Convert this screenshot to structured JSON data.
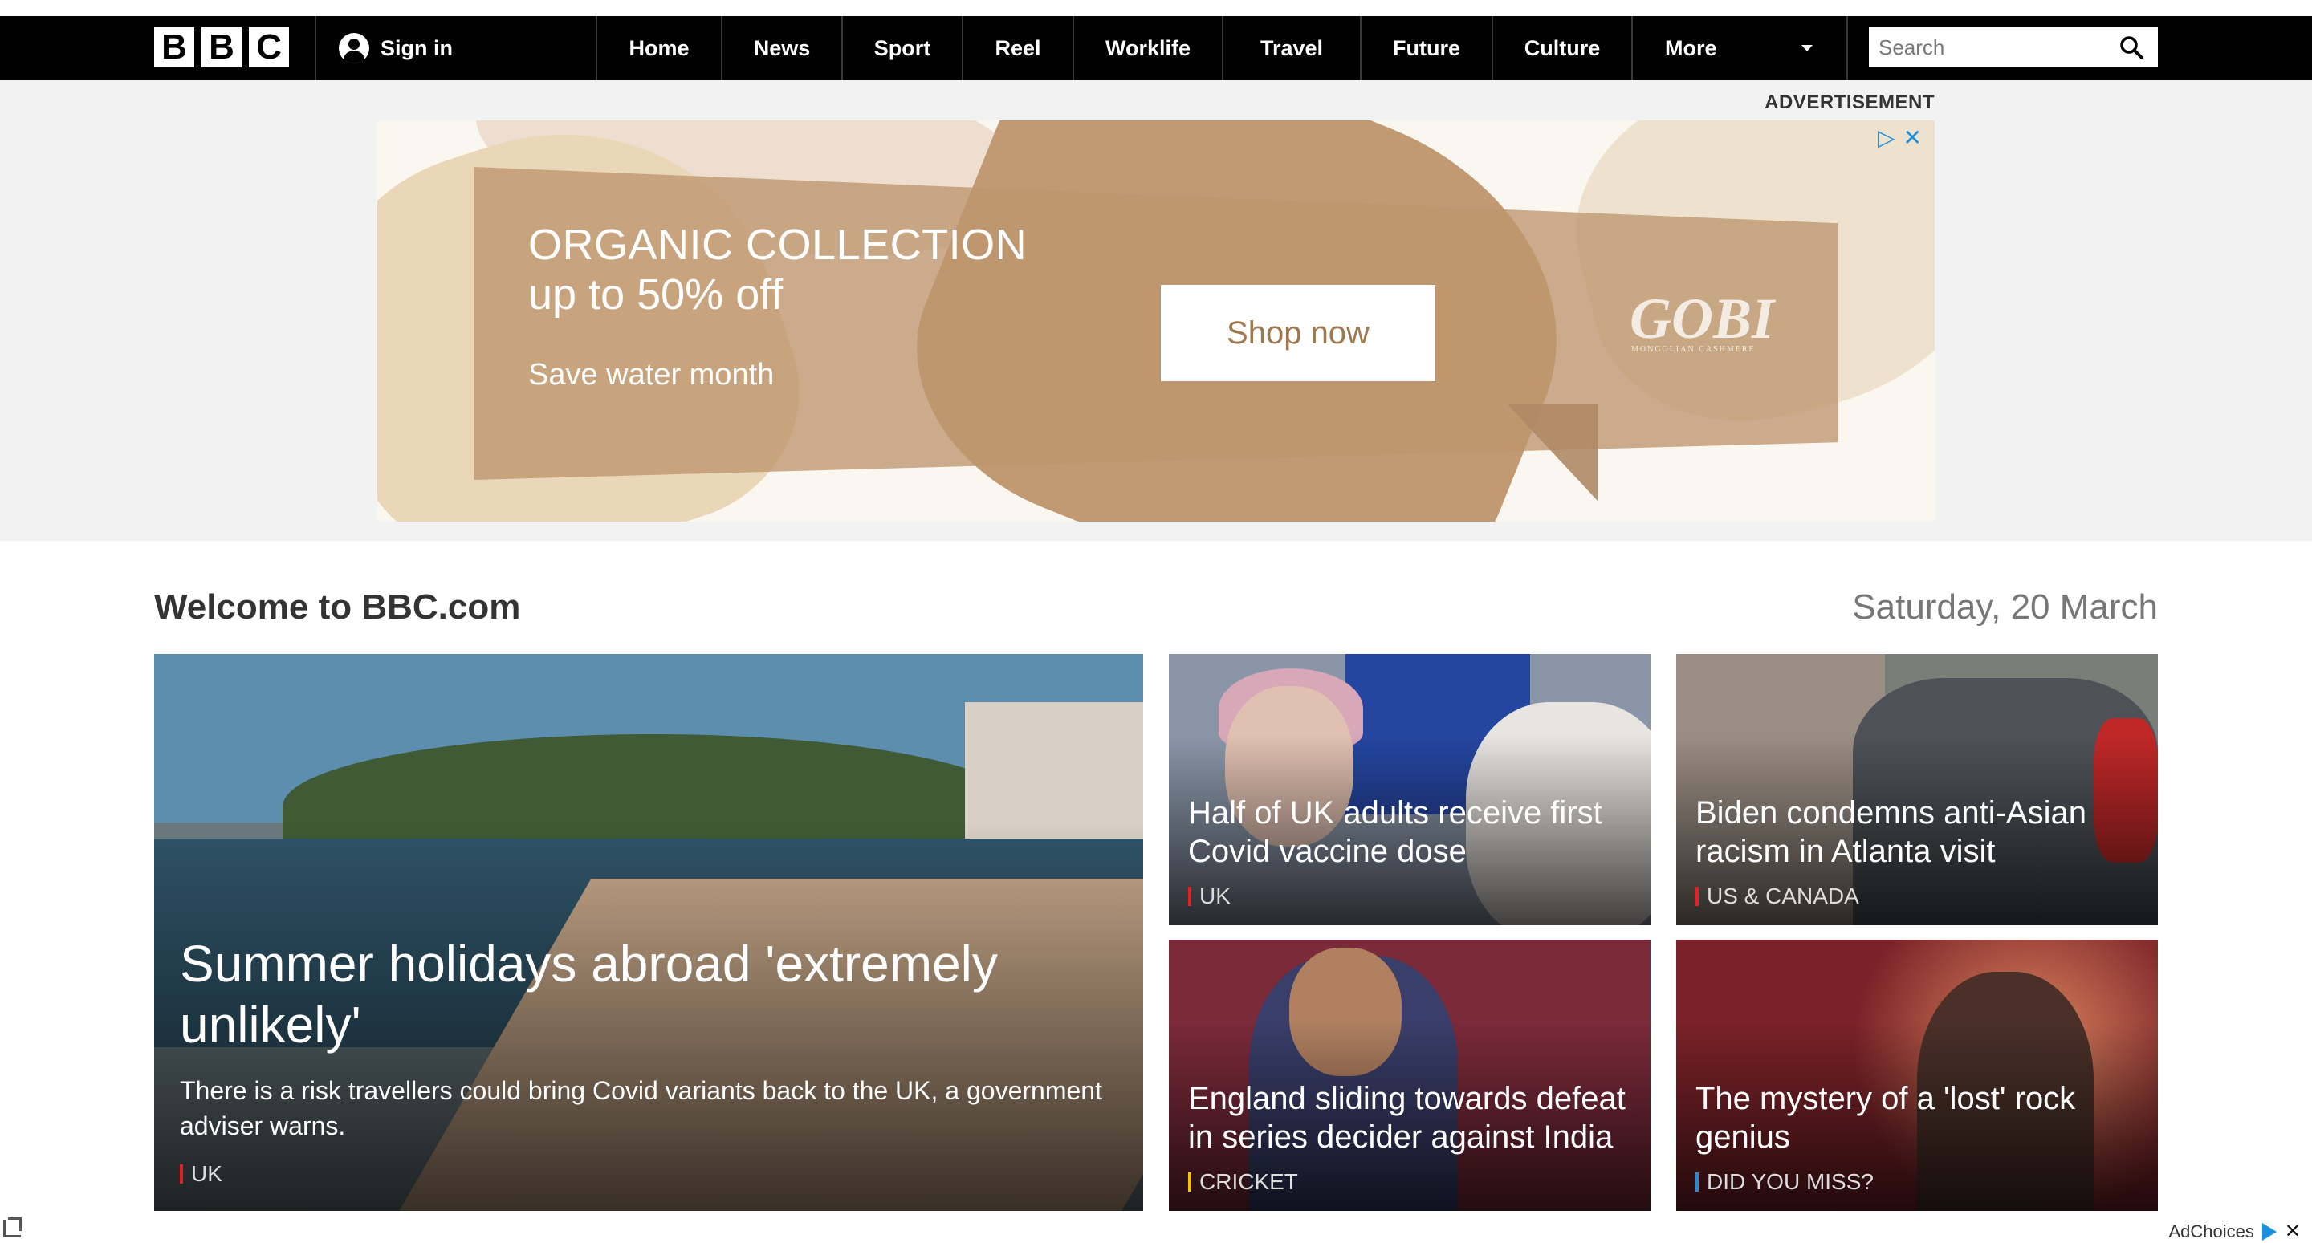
{
  "nav": {
    "logo_letters": [
      "B",
      "B",
      "C"
    ],
    "sign_in_label": "Sign in",
    "items": [
      "Home",
      "News",
      "Sport",
      "Reel",
      "Worklife",
      "Travel",
      "Future",
      "Culture"
    ],
    "more_label": "More",
    "search_placeholder": "Search"
  },
  "ad": {
    "label": "ADVERTISEMENT",
    "headline_line1": "ORGANIC COLLECTION",
    "headline_line2": "up to 50% off",
    "subtext": "Save water month",
    "cta_label": "Shop now",
    "brand": "GOBI",
    "brand_sub": "MONGOLIAN CASHMERE",
    "colors": {
      "banner": "#be966e",
      "cta_text": "#a07850",
      "adchoices": "#1a8fe0"
    }
  },
  "welcome": {
    "title": "Welcome to BBC.com",
    "date": "Saturday, 20 March"
  },
  "stories": {
    "main": {
      "title": "Summer holidays abroad 'extremely unlikely'",
      "summary": "There is a risk travellers could bring Covid variants back to the UK, a government adviser warns.",
      "category": "UK",
      "category_color": "#e62020"
    },
    "s1": {
      "title": "Half of UK adults receive first Covid vaccine dose",
      "category": "UK",
      "category_color": "#e62020"
    },
    "s2": {
      "title": "Biden condemns anti-Asian racism in Atlanta visit",
      "category": "US & CANADA",
      "category_color": "#e62020"
    },
    "s3": {
      "title": "England sliding towards defeat in series decider against India",
      "category": "CRICKET",
      "category_color": "#f5c400"
    },
    "s4": {
      "title": "The mystery of a 'lost' rock genius",
      "category": "DID YOU MISS?",
      "category_color": "#2a8ad0"
    }
  },
  "footer": {
    "adchoices_label": "AdChoices"
  }
}
